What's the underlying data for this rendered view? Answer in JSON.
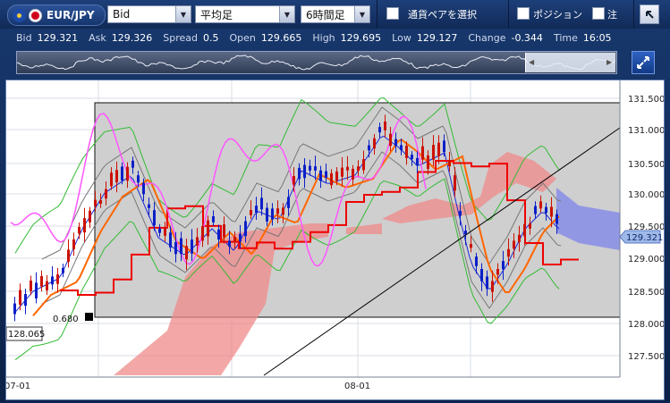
{
  "toolbar": {
    "pair_label": "EUR/JPY",
    "price_type": "Bid",
    "candle_type": "平均足",
    "timeframe": "6時間足",
    "select_pair_label": "通貨ペアを選択",
    "position_label": "ポジション",
    "order_label": "注"
  },
  "quote": {
    "bid_label": "Bid",
    "bid": "129.321",
    "ask_label": "Ask",
    "ask": "129.326",
    "spread_label": "Spread",
    "spread": "0.5",
    "open_label": "Open",
    "open": "129.665",
    "high_label": "High",
    "high": "129.695",
    "low_label": "Low",
    "low": "129.127",
    "change_label": "Change",
    "change": "-0.344",
    "time_label": "Time",
    "time": "16:05"
  },
  "chart": {
    "y_ticks": [
      "131.500",
      "131.000",
      "130.500",
      "130.000",
      "129.500",
      "129.000",
      "128.500",
      "128.000",
      "127.500"
    ],
    "x_ticks": [
      "07-01",
      "08-01"
    ],
    "current_price": "129.321",
    "box_low_label": "128.065",
    "box_marker_label": "0.680",
    "colors": {
      "up_candle": "#cc1100",
      "down_candle": "#0a1fc8",
      "cloud_bull": "#f08a8a",
      "cloud_bear": "#8b90e6",
      "bollinger": "#33bb33",
      "ma_short": "#ff6600",
      "ma_long": "#ee0000",
      "oscillator": "#ff55ff"
    }
  }
}
